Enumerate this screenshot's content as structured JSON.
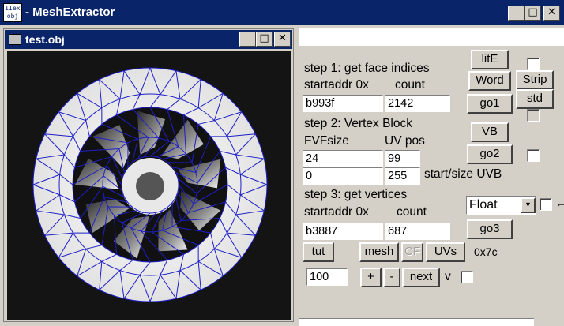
{
  "app": {
    "title": "MeshExtractor",
    "icon_text": "IIex obj",
    "window_buttons": [
      "_",
      "□",
      "✕"
    ]
  },
  "child": {
    "title": "test.obj",
    "window_buttons": [
      "_",
      "□",
      "✕"
    ]
  },
  "step1": {
    "label": "step 1: get face indices",
    "startaddr_label": "startaddr 0x",
    "count_label": "count",
    "startaddr_value": "b993f",
    "count_value": "2142",
    "lite_button": "litE",
    "word_button": "Word",
    "strip_button": "Strip",
    "std_button": "std",
    "go_button": "go1"
  },
  "step2": {
    "label": "step 2: Vertex Block",
    "fvf_label": "FVFsize",
    "uvpos_label": "UV pos",
    "fvf_value": "24",
    "uvpos_value": "99",
    "start_value": "0",
    "size_value": "255",
    "uvb_label": "start/size UVB",
    "vb_button": "VB",
    "go_button": "go2"
  },
  "step3": {
    "label": "step 3: get vertices",
    "startaddr_label": "startaddr 0x",
    "count_label": "count",
    "startaddr_value": "b3887",
    "count_value": "687",
    "type_select": "Float",
    "go_button": "go3"
  },
  "bottom": {
    "tut_button": "tut",
    "mesh_button": "mesh",
    "cf_button": "CF",
    "uvs_button": "UVs",
    "hex_label": "0x7c",
    "step_value": "100",
    "plus_button": "+",
    "minus_button": "-",
    "next_button": "next",
    "v_label": "v"
  },
  "colors": {
    "titlebar": "#0a246a",
    "face": "#d4d0c8",
    "wire": "#1e1ec8",
    "viewport": "#141414"
  }
}
